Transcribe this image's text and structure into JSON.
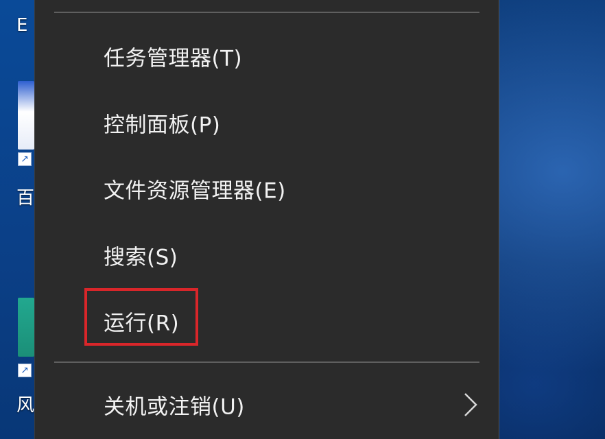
{
  "desktop": {
    "icon_labels": [
      "E",
      "百",
      "风"
    ]
  },
  "menu": {
    "items": [
      {
        "label": "任务管理器(T)"
      },
      {
        "label": "控制面板(P)"
      },
      {
        "label": "文件资源管理器(E)"
      },
      {
        "label": "搜索(S)"
      },
      {
        "label": "运行(R)",
        "highlighted": true
      },
      {
        "label": "关机或注销(U)",
        "has_submenu": true
      }
    ]
  },
  "colors": {
    "menu_background": "#2b2b2b",
    "menu_text": "#f2f2f2",
    "separator": "#5f5f5f",
    "highlight_border": "#d9262a",
    "desktop_blue": "#0a3470"
  },
  "icons": {
    "submenu": "chevron-right-icon",
    "shortcut": "shortcut-arrow-icon"
  }
}
